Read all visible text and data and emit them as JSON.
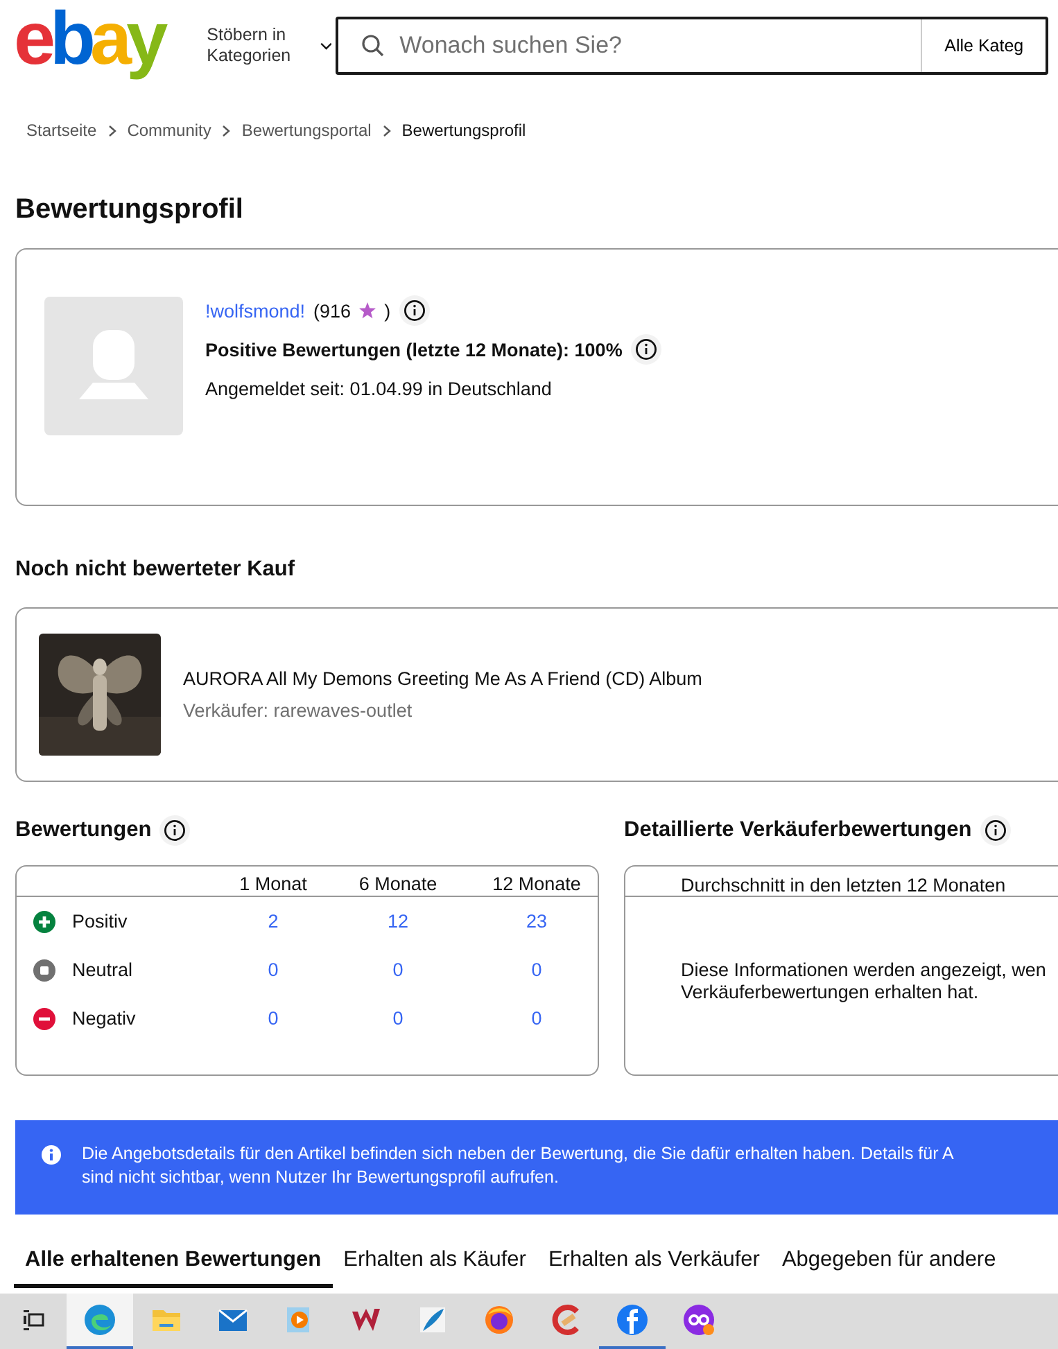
{
  "header": {
    "logo": "ebay",
    "browse": "Stöbern in Kategorien",
    "search": {
      "placeholder": "Wonach suchen Sie?"
    },
    "category": "Alle Kateg"
  },
  "breadcrumb": [
    "Startseite",
    "Community",
    "Bewertungsportal",
    "Bewertungsprofil"
  ],
  "title": "Bewertungsprofil",
  "profile": {
    "username": "!wolfsmond!",
    "score": "(916",
    "score_end": ")",
    "positive": "Positive Bewertungen (letzte 12 Monate): 100%",
    "member_since": "Angemeldet seit: 01.04.99 in Deutschland"
  },
  "pending": {
    "heading": "Noch nicht bewerteter Kauf",
    "item": {
      "kind": "picture",
      "title": "AURORA All My Demons Greeting Me As A Friend (CD) Album",
      "seller": "Verkäufer: rarewaves-outlet"
    }
  },
  "ratings": {
    "heading": "Bewertungen",
    "columns": [
      "1 Monat",
      "6 Monate",
      "12 Monate"
    ],
    "rows": [
      {
        "kind": "positive",
        "label": "Positiv",
        "values": [
          "2",
          "12",
          "23"
        ]
      },
      {
        "kind": "neutral",
        "label": "Neutral",
        "values": [
          "0",
          "0",
          "0"
        ]
      },
      {
        "kind": "negative",
        "label": "Negativ",
        "values": [
          "0",
          "0",
          "0"
        ]
      }
    ]
  },
  "seller_ratings": {
    "heading": "Detaillierte Verkäuferbewertungen",
    "column": "Durchschnitt in den letzten 12 Monaten",
    "message": "Diese Informationen werden angezeigt, wen Verkäuferbewertungen erhalten hat."
  },
  "notice": [
    "Die Angebotsdetails für den Artikel befinden sich neben der Bewertung, die Sie dafür erhalten haben. Details für A",
    "sind nicht sichtbar, wenn Nutzer Ihr Bewertungsprofil aufrufen."
  ],
  "tabs": [
    {
      "label": "Alle erhaltenen Bewertungen",
      "selected": true
    },
    {
      "label": "Erhalten als Käufer",
      "selected": false
    },
    {
      "label": "Erhalten als Verkäufer",
      "selected": false
    },
    {
      "label": "Abgegeben für andere",
      "selected": false
    }
  ],
  "taskbar": [
    {
      "selected": true,
      "running": true
    },
    {
      "selected": false,
      "running": false
    },
    {
      "selected": false,
      "running": false
    },
    {
      "selected": false,
      "running": false
    },
    {
      "selected": false,
      "running": false
    },
    {
      "selected": false,
      "running": false
    },
    {
      "selected": false,
      "running": false
    },
    {
      "selected": false,
      "running": false
    },
    {
      "selected": false,
      "running": true
    },
    {
      "selected": false,
      "running": false
    }
  ]
}
